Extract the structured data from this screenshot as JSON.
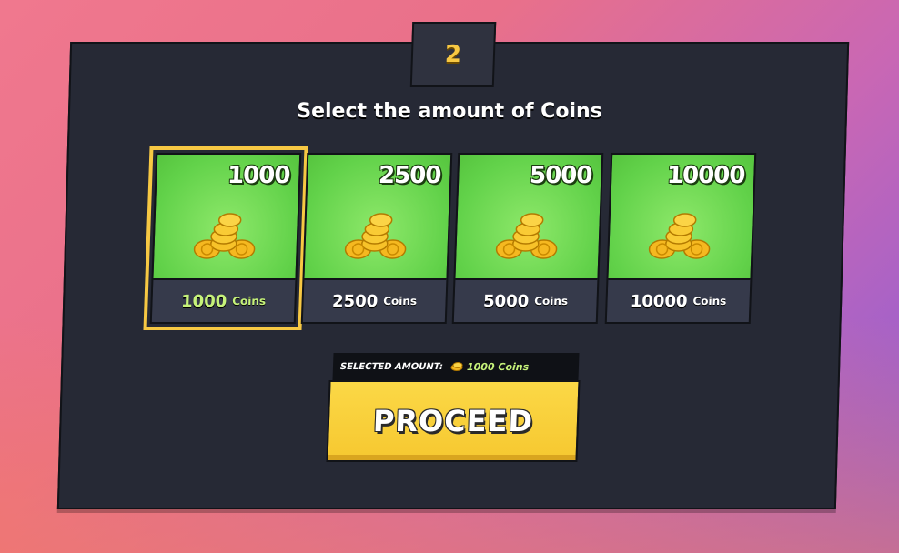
{
  "step": {
    "number": "2"
  },
  "title": "Select the amount of Coins",
  "options": [
    {
      "amount": "1000",
      "label_number": "1000",
      "label_unit": "Coins",
      "selected": true
    },
    {
      "amount": "2500",
      "label_number": "2500",
      "label_unit": "Coins",
      "selected": false
    },
    {
      "amount": "5000",
      "label_number": "5000",
      "label_unit": "Coins",
      "selected": false
    },
    {
      "amount": "10000",
      "label_number": "10000",
      "label_unit": "Coins",
      "selected": false
    }
  ],
  "selection": {
    "caption": "SELECTED AMOUNT:",
    "value": "1000 Coins",
    "icon": "coin-icon"
  },
  "proceed_label": "PROCEED",
  "colors": {
    "accent_yellow": "#f7c843",
    "card_green": "#62d24a",
    "panel": "#262935",
    "selected_text": "#c6f27a"
  }
}
